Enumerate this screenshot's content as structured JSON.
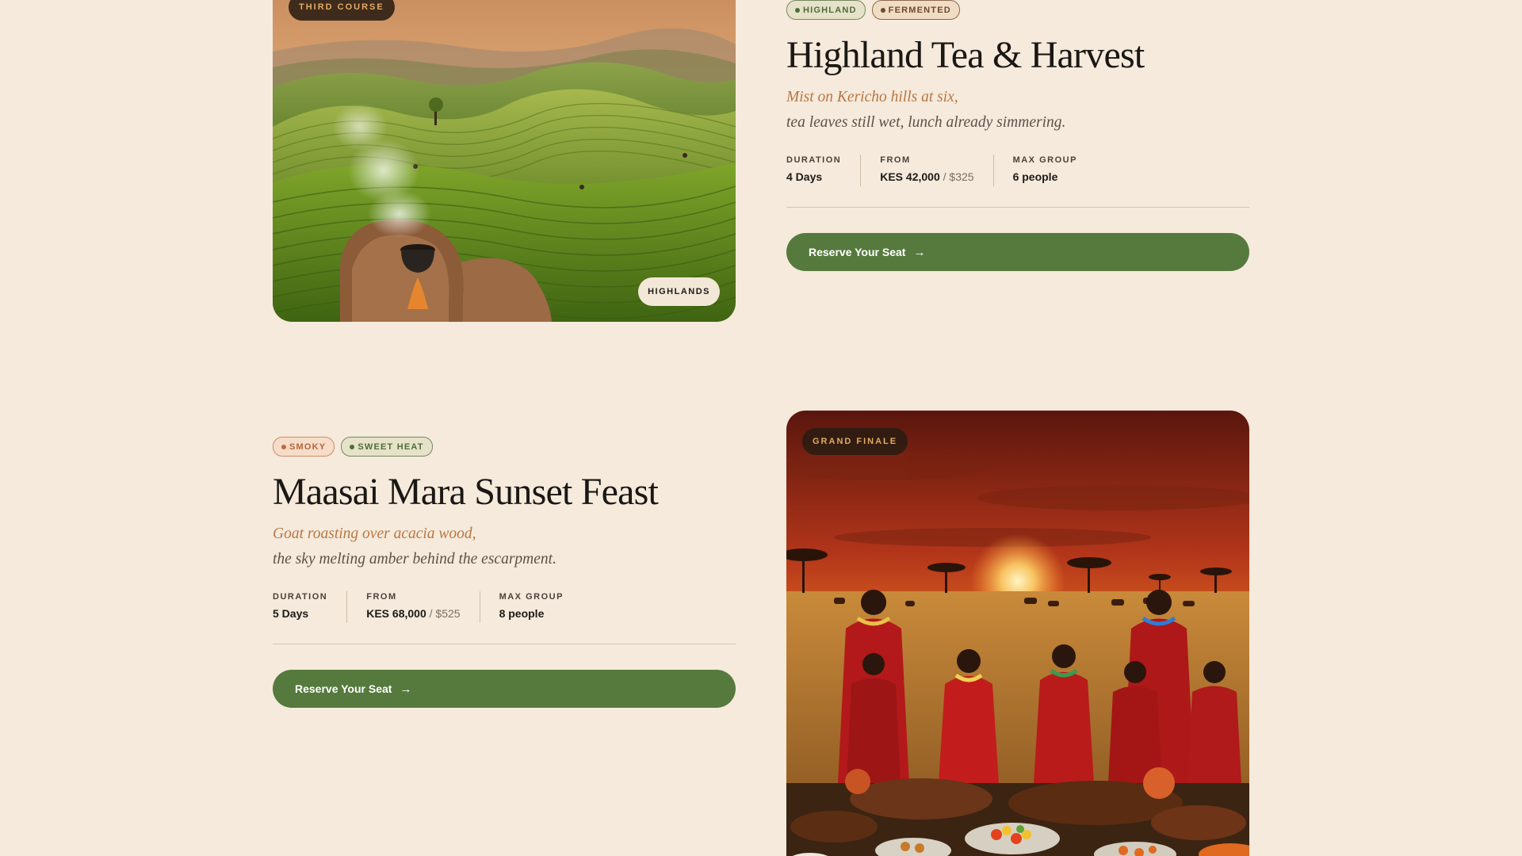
{
  "courses": [
    {
      "course_label": "THIRD COURSE",
      "region_label": "HIGHLANDS",
      "tags": [
        {
          "label": "HIGHLAND",
          "style": "green"
        },
        {
          "label": "FERMENTED",
          "style": "brown"
        }
      ],
      "title": "Highland Tea & Harvest",
      "tagline_1": "Mist on Kericho hills at six,",
      "tagline_2": "tea leaves still wet, lunch already simmering.",
      "stats": {
        "duration_label": "DURATION",
        "duration_value": "4 Days",
        "from_label": "FROM",
        "from_kes": "KES 42,000",
        "from_usd": "/ $325",
        "group_label": "MAX GROUP",
        "group_value": "6 people"
      },
      "cta_label": "Reserve Your Seat"
    },
    {
      "course_label": "GRAND FINALE",
      "tags": [
        {
          "label": "SMOKY",
          "style": "rust"
        },
        {
          "label": "SWEET HEAT",
          "style": "green"
        }
      ],
      "title": "Maasai Mara Sunset Feast",
      "tagline_1": "Goat roasting over acacia wood,",
      "tagline_2": "the sky melting amber behind the escarpment.",
      "stats": {
        "duration_label": "DURATION",
        "duration_value": "5 Days",
        "from_label": "FROM",
        "from_kes": "KES 68,000",
        "from_usd": "/ $525",
        "group_label": "MAX GROUP",
        "group_value": "8 people"
      },
      "cta_label": "Reserve Your Seat"
    }
  ],
  "icons": {
    "tag_dot": "dot-icon",
    "cta_arrow": "arrow-right-icon"
  },
  "colors": {
    "background": "#f5eadb",
    "cta_green": "#567a3e",
    "tagline_accent": "#b87645",
    "course_pill_text": "#e2ab63"
  }
}
